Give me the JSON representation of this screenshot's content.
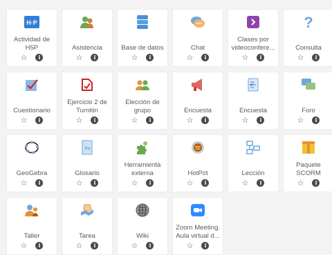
{
  "tiles": [
    {
      "label": "Actividad de H5P",
      "icon": "h5p-icon"
    },
    {
      "label": "Asistencia",
      "icon": "attendance-icon"
    },
    {
      "label": "Base de datos",
      "icon": "database-icon"
    },
    {
      "label": "Chat",
      "icon": "chat-icon"
    },
    {
      "label": "Clases por videoconfere...",
      "icon": "videoconference-icon"
    },
    {
      "label": "Consulta",
      "icon": "question-icon"
    },
    {
      "label": "Cuestionario",
      "icon": "quiz-icon"
    },
    {
      "label": "Ejercicio 2 de Turnitin",
      "icon": "turnitin-icon"
    },
    {
      "label": "Elección de grupo",
      "icon": "group-choice-icon"
    },
    {
      "label": "Encuesta",
      "icon": "megaphone-icon"
    },
    {
      "label": "Encuesta",
      "icon": "survey-icon"
    },
    {
      "label": "Foro",
      "icon": "forum-icon"
    },
    {
      "label": "GeoGebra",
      "icon": "geogebra-icon"
    },
    {
      "label": "Glosario",
      "icon": "glossary-icon"
    },
    {
      "label": "Herramienta externa",
      "icon": "puzzle-icon"
    },
    {
      "label": "HotPot",
      "icon": "hotpot-icon"
    },
    {
      "label": "Lección",
      "icon": "lesson-icon"
    },
    {
      "label": "Paquete SCORM",
      "icon": "scorm-icon"
    },
    {
      "label": "Taller",
      "icon": "workshop-icon"
    },
    {
      "label": "Tarea",
      "icon": "assignment-icon"
    },
    {
      "label": "Wiki",
      "icon": "wiki-icon"
    },
    {
      "label": "Zoom Meeting. Aula virtual d...",
      "icon": "zoom-icon"
    }
  ],
  "star_glyph": "☆",
  "info_glyph": "i"
}
